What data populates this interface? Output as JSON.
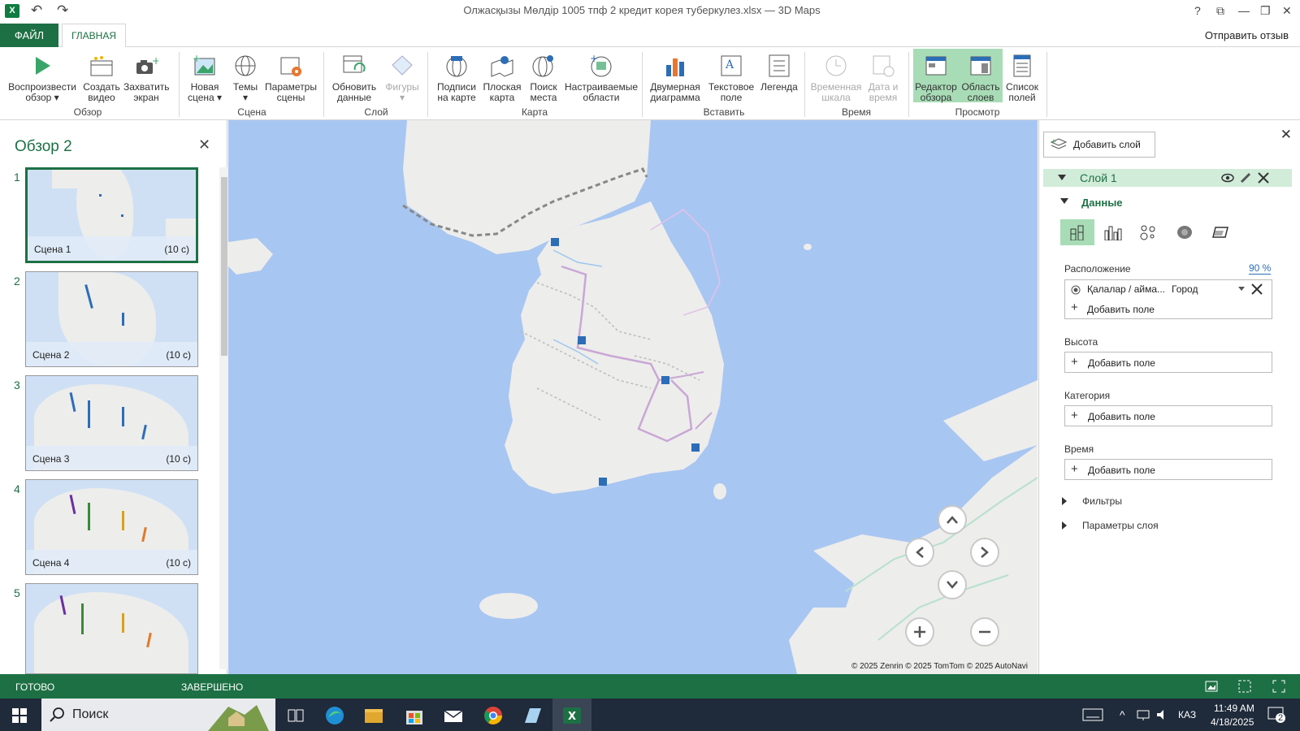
{
  "window": {
    "title": "Олжасқызы Мөлдір 1005 тпф 2 кредит корея туберкулез.xlsx — 3D Maps",
    "app_icon_letter": "X",
    "undo": "↶",
    "redo": "↷",
    "help": "?",
    "restore": "⧉",
    "minimize": "—",
    "maximize": "❐",
    "close": "✕"
  },
  "tabs": {
    "file": "ФАЙЛ",
    "home": "ГЛАВНАЯ",
    "feedback": "Отправить отзыв"
  },
  "ribbon": {
    "groups": {
      "review": "Обзор",
      "scene": "Сцена",
      "layer": "Слой",
      "map": "Карта",
      "insert": "Вставить",
      "time": "Время",
      "view": "Просмотр"
    },
    "buttons": {
      "play": [
        "Воспроизвести",
        "обзор ▾"
      ],
      "create_video": [
        "Создать",
        "видео"
      ],
      "capture": [
        "Захватить",
        "экран"
      ],
      "new_scene": [
        "Новая",
        "сцена ▾"
      ],
      "themes": [
        "Темы",
        "▾"
      ],
      "scene_params": [
        "Параметры",
        "сцены"
      ],
      "refresh": [
        "Обновить",
        "данные"
      ],
      "shapes": [
        "Фигуры",
        "▾"
      ],
      "map_labels": [
        "Подписи",
        "на карте"
      ],
      "flat_map": [
        "Плоская",
        "карта"
      ],
      "find_place": [
        "Поиск",
        "места"
      ],
      "custom_regions": [
        "Настраиваемые",
        "области"
      ],
      "chart2d": [
        "Двумерная",
        "диаграмма"
      ],
      "textbox": [
        "Текстовое",
        "поле"
      ],
      "legend": [
        "Легенда",
        ""
      ],
      "timeline": [
        "Временная",
        "шкала"
      ],
      "datetime": [
        "Дата и",
        "время"
      ],
      "tour_editor": [
        "Редактор",
        "обзора"
      ],
      "layers_pane": [
        "Область",
        "слоев"
      ],
      "fields_list": [
        "Список",
        "полей"
      ]
    }
  },
  "tour": {
    "title": "Обзор 2",
    "close": "✕",
    "scenes": [
      {
        "num": "1",
        "name": "Сцена 1",
        "duration": "(10 с)"
      },
      {
        "num": "2",
        "name": "Сцена 2",
        "duration": "(10 с)"
      },
      {
        "num": "3",
        "name": "Сцена 3",
        "duration": "(10 с)"
      },
      {
        "num": "4",
        "name": "Сцена 4",
        "duration": "(10 с)"
      },
      {
        "num": "5",
        "name": "",
        "duration": ""
      }
    ]
  },
  "map": {
    "copyright": "© 2025 Zenrin  © 2025 TomTom  © 2025 AutoNavi",
    "colors": {
      "water": "#a8c6f2",
      "land": "#ededeb",
      "marker": "#2c6db8",
      "route": "#c9a7d6"
    }
  },
  "layer_pane": {
    "add_layer": "Добавить слой",
    "close": "✕",
    "layer_name": "Слой 1",
    "data_header": "Данные",
    "location_label": "Расположение",
    "location_pct": "90 %",
    "location_field": "Қалалар / айма...",
    "location_type": "Город",
    "add_field": "Добавить поле",
    "height_label": "Высота",
    "category_label": "Категория",
    "time_label": "Время",
    "filters": "Фильтры",
    "layer_params": "Параметры слоя"
  },
  "status": {
    "ready": "ГОТОВО",
    "done": "ЗАВЕРШЕНО"
  },
  "taskbar": {
    "search": "Поиск",
    "lang": "КАЗ",
    "time": "11:49 AM",
    "date": "4/18/2025",
    "notif": "2"
  }
}
